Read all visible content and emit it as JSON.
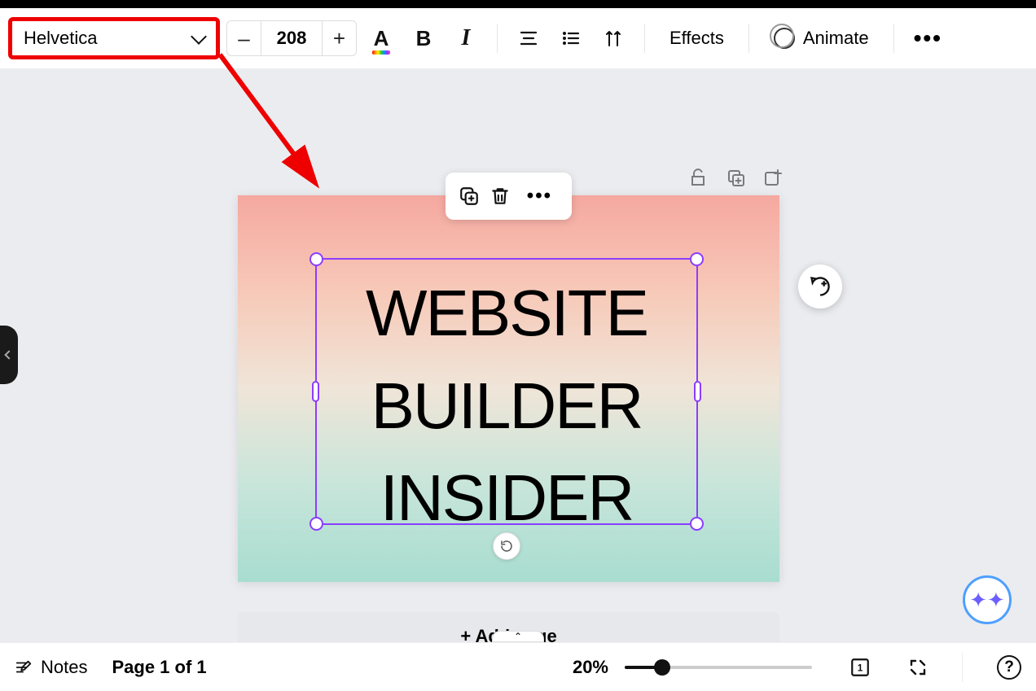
{
  "toolbar": {
    "font_name": "Helvetica",
    "font_size": "208",
    "minus": "–",
    "plus": "+",
    "effects_label": "Effects",
    "animate_label": "Animate"
  },
  "canvas": {
    "text_line1": "WEBSITE",
    "text_line2": "BUILDER",
    "text_line3": "INSIDER",
    "add_page_label": "+ Add page"
  },
  "bottombar": {
    "notes_label": "Notes",
    "page_indicator": "Page 1 of 1",
    "zoom_label": "20%",
    "zoom_percent": 20,
    "help": "?"
  }
}
